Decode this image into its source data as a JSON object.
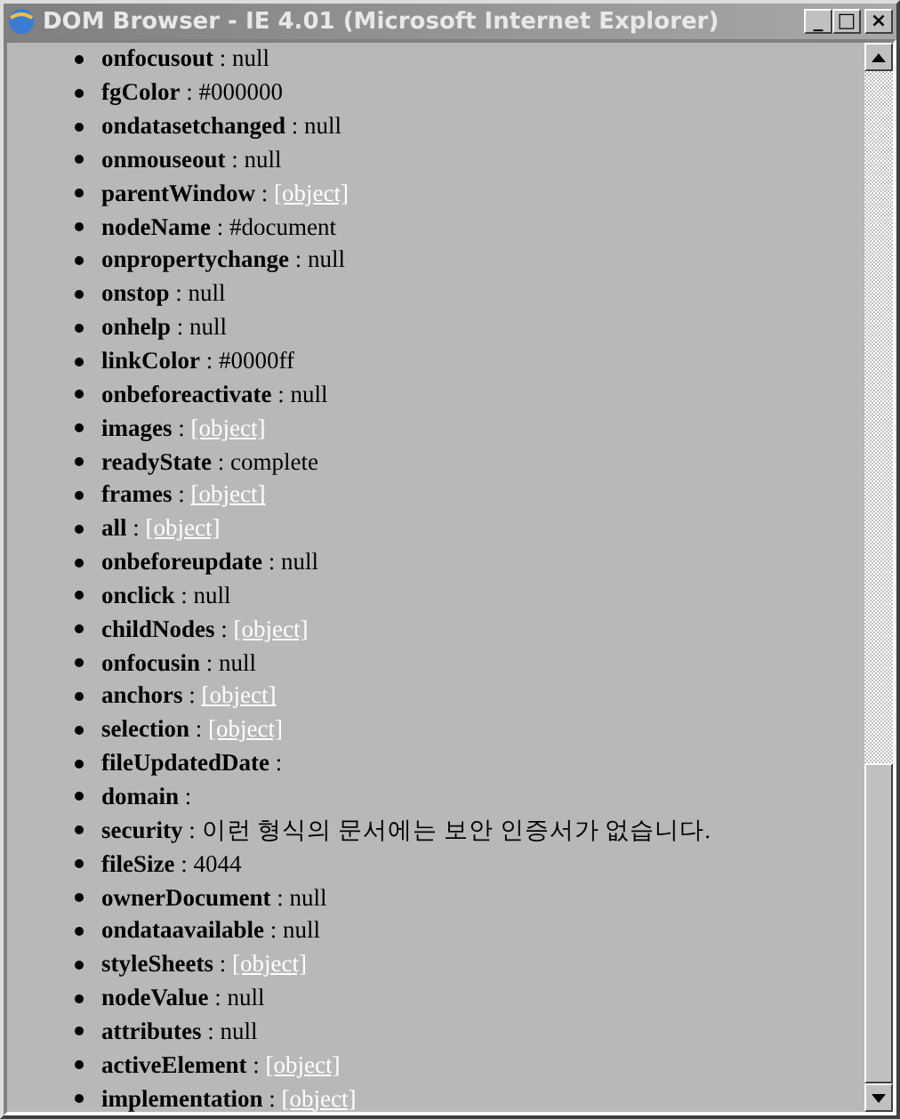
{
  "window": {
    "title": "DOM Browser - IE 4.01 (Microsoft Internet Explorer)",
    "controls": [
      "_",
      "□",
      "×"
    ]
  },
  "separator": ":",
  "properties": [
    {
      "name": "onfocusout",
      "kind": "text",
      "value": "null"
    },
    {
      "name": "fgColor",
      "kind": "text",
      "value": "#000000"
    },
    {
      "name": "ondatasetchanged",
      "kind": "text",
      "value": "null"
    },
    {
      "name": "onmouseout",
      "kind": "text",
      "value": "null"
    },
    {
      "name": "parentWindow",
      "kind": "link",
      "value": "[object]"
    },
    {
      "name": "nodeName",
      "kind": "text",
      "value": "#document"
    },
    {
      "name": "onpropertychange",
      "kind": "text",
      "value": "null"
    },
    {
      "name": "onstop",
      "kind": "text",
      "value": "null"
    },
    {
      "name": "onhelp",
      "kind": "text",
      "value": "null"
    },
    {
      "name": "linkColor",
      "kind": "text",
      "value": "#0000ff"
    },
    {
      "name": "onbeforeactivate",
      "kind": "text",
      "value": "null"
    },
    {
      "name": "images",
      "kind": "link",
      "value": "[object]"
    },
    {
      "name": "readyState",
      "kind": "text",
      "value": "complete"
    },
    {
      "name": "frames",
      "kind": "link",
      "value": "[object]"
    },
    {
      "name": "all",
      "kind": "link",
      "value": "[object]"
    },
    {
      "name": "onbeforeupdate",
      "kind": "text",
      "value": "null"
    },
    {
      "name": "onclick",
      "kind": "text",
      "value": "null"
    },
    {
      "name": "childNodes",
      "kind": "link",
      "value": "[object]"
    },
    {
      "name": "onfocusin",
      "kind": "text",
      "value": "null"
    },
    {
      "name": "anchors",
      "kind": "link",
      "value": "[object]"
    },
    {
      "name": "selection",
      "kind": "link",
      "value": "[object]"
    },
    {
      "name": "fileUpdatedDate",
      "kind": "empty"
    },
    {
      "name": "domain",
      "kind": "empty"
    },
    {
      "name": "security",
      "kind": "text",
      "value": "이런 형식의 문서에는 보안 인증서가 없습니다."
    },
    {
      "name": "fileSize",
      "kind": "text",
      "value": "4044"
    },
    {
      "name": "ownerDocument",
      "kind": "text",
      "value": "null"
    },
    {
      "name": "ondataavailable",
      "kind": "text",
      "value": "null"
    },
    {
      "name": "styleSheets",
      "kind": "link",
      "value": "[object]"
    },
    {
      "name": "nodeValue",
      "kind": "text",
      "value": "null"
    },
    {
      "name": "attributes",
      "kind": "text",
      "value": "null"
    },
    {
      "name": "activeElement",
      "kind": "link",
      "value": "[object]"
    },
    {
      "name": "implementation",
      "kind": "link",
      "value": "[object]"
    }
  ]
}
